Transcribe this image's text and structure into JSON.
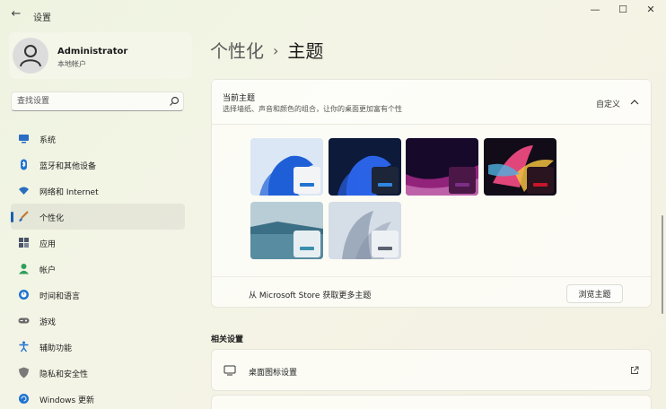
{
  "window": {
    "title": "设置",
    "back_glyph": "←",
    "minimize_glyph": "—",
    "maximize_glyph": "☐",
    "close_glyph": "✕"
  },
  "user": {
    "name": "Administrator",
    "account_type": "本地帐户"
  },
  "search": {
    "placeholder": "查找设置"
  },
  "sidebar": {
    "items": [
      {
        "label": "系统",
        "icon": "monitor-icon",
        "color": "#2b6cc4"
      },
      {
        "label": "蓝牙和其他设备",
        "icon": "bluetooth-icon",
        "color": "#1f73d1"
      },
      {
        "label": "网络和 Internet",
        "icon": "wifi-icon",
        "color": "#2a6fbf"
      },
      {
        "label": "个性化",
        "icon": "brush-icon",
        "color": "#c0752b",
        "active": true
      },
      {
        "label": "应用",
        "icon": "apps-icon",
        "color": "#4a5568"
      },
      {
        "label": "帐户",
        "icon": "person-icon",
        "color": "#2f9e5b"
      },
      {
        "label": "时间和语言",
        "icon": "globe-clock-icon",
        "color": "#1f73d1"
      },
      {
        "label": "游戏",
        "icon": "gamepad-icon",
        "color": "#6b6b6b"
      },
      {
        "label": "辅助功能",
        "icon": "accessibility-icon",
        "color": "#1f6fd1"
      },
      {
        "label": "隐私和安全性",
        "icon": "shield-icon",
        "color": "#6b6b6b"
      },
      {
        "label": "Windows 更新",
        "icon": "update-icon",
        "color": "#1f73d1"
      }
    ]
  },
  "breadcrumb": {
    "parent": "个性化",
    "separator": "›",
    "current": "主题"
  },
  "current_theme": {
    "title": "当前主题",
    "description": "选择墙纸、声音和颜色的组合，让你的桌面更加富有个性",
    "value": "自定义",
    "themes": [
      {
        "icon": "bloom-light-wallpaper",
        "bg1": "#dbe7f5",
        "bg2": "#1e5fd8",
        "mini": "#f3f4f6",
        "bar": "#1f73d1"
      },
      {
        "icon": "bloom-dark-wallpaper",
        "bg1": "#0d1a3a",
        "bg2": "#2a63e6",
        "mini": "#1d2538",
        "bar": "#2f86e0"
      },
      {
        "icon": "glow-wallpaper",
        "bg1": "#16092a",
        "bg2": "#b22a8e",
        "mini": "#4a1747",
        "bar": "#7a2f86"
      },
      {
        "icon": "captured-motion-wallpaper",
        "bg1": "#120c18",
        "bg2": "#e0467a",
        "mini": "#2a1420",
        "bar": "#c8162a"
      },
      {
        "icon": "lake-wallpaper",
        "bg1": "#b9cdd6",
        "bg2": "#3b6f86",
        "mini": "#e7eef2",
        "bar": "#3a8fae"
      },
      {
        "icon": "flow-wallpaper",
        "bg1": "#d5dde6",
        "bg2": "#7a8aa0",
        "mini": "#eef1f4",
        "bar": "#5a6270"
      }
    ],
    "store_text": "从 Microsoft Store 获取更多主题",
    "browse_label": "浏览主题"
  },
  "related": {
    "title": "相关设置",
    "items": [
      {
        "label": "桌面图标设置",
        "icon": "desktop-icon"
      }
    ]
  }
}
